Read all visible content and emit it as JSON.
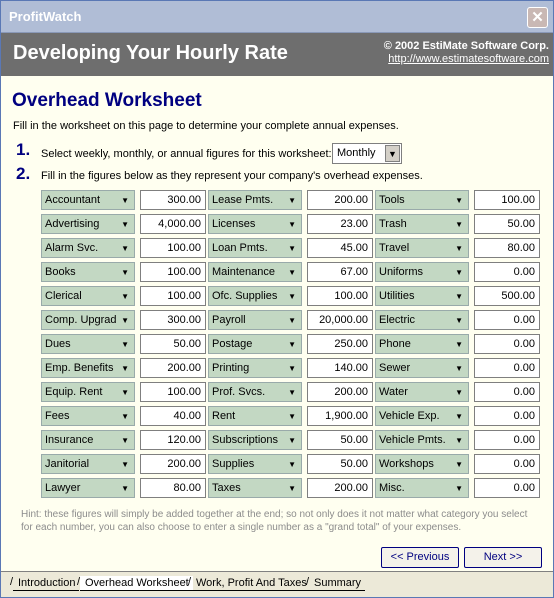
{
  "window": {
    "title": "ProfitWatch",
    "close_glyph": "✕"
  },
  "header": {
    "title": "Developing Your Hourly Rate",
    "copyright": "© 2002 EstiMate Software Corp.",
    "url": "http://www.estimatesoftware.com"
  },
  "worksheet": {
    "title": "Overhead Worksheet",
    "intro": "Fill in the worksheet on this page to determine your complete annual expenses.",
    "step1_number": "1.",
    "step1_text": "Select weekly, monthly, or annual figures for this worksheet:",
    "period_value": "Monthly",
    "step2_number": "2.",
    "step2_text": "Fill in the figures below as they represent your company's overhead expenses.",
    "columns": [
      [
        {
          "label": "Accountant",
          "amount": "300.00"
        },
        {
          "label": "Advertising",
          "amount": "4,000.00"
        },
        {
          "label": "Alarm Svc.",
          "amount": "100.00"
        },
        {
          "label": "Books",
          "amount": "100.00"
        },
        {
          "label": "Clerical",
          "amount": "100.00"
        },
        {
          "label": "Comp. Upgrad",
          "amount": "300.00"
        },
        {
          "label": "Dues",
          "amount": "50.00"
        },
        {
          "label": "Emp. Benefits",
          "amount": "200.00"
        },
        {
          "label": "Equip. Rent",
          "amount": "100.00"
        },
        {
          "label": "Fees",
          "amount": "40.00"
        },
        {
          "label": "Insurance",
          "amount": "120.00"
        },
        {
          "label": "Janitorial",
          "amount": "200.00"
        },
        {
          "label": "Lawyer",
          "amount": "80.00"
        }
      ],
      [
        {
          "label": "Lease Pmts.",
          "amount": "200.00"
        },
        {
          "label": "Licenses",
          "amount": "23.00"
        },
        {
          "label": "Loan Pmts.",
          "amount": "45.00"
        },
        {
          "label": "Maintenance",
          "amount": "67.00"
        },
        {
          "label": "Ofc. Supplies",
          "amount": "100.00"
        },
        {
          "label": "Payroll",
          "amount": "20,000.00"
        },
        {
          "label": "Postage",
          "amount": "250.00"
        },
        {
          "label": "Printing",
          "amount": "140.00"
        },
        {
          "label": "Prof. Svcs.",
          "amount": "200.00"
        },
        {
          "label": "Rent",
          "amount": "1,900.00"
        },
        {
          "label": "Subscriptions",
          "amount": "50.00"
        },
        {
          "label": "Supplies",
          "amount": "50.00"
        },
        {
          "label": "Taxes",
          "amount": "200.00"
        }
      ],
      [
        {
          "label": "Tools",
          "amount": "100.00"
        },
        {
          "label": "Trash",
          "amount": "50.00"
        },
        {
          "label": "Travel",
          "amount": "80.00"
        },
        {
          "label": "Uniforms",
          "amount": "0.00"
        },
        {
          "label": "Utilities",
          "amount": "500.00"
        },
        {
          "label": "Electric",
          "amount": "0.00"
        },
        {
          "label": "Phone",
          "amount": "0.00"
        },
        {
          "label": "Sewer",
          "amount": "0.00"
        },
        {
          "label": "Water",
          "amount": "0.00"
        },
        {
          "label": "Vehicle Exp.",
          "amount": "0.00"
        },
        {
          "label": "Vehicle Pmts.",
          "amount": "0.00"
        },
        {
          "label": "Workshops",
          "amount": "0.00"
        },
        {
          "label": "Misc.",
          "amount": "0.00"
        }
      ]
    ],
    "dropdown_glyph": "▼",
    "hint": "Hint: these figures will simply be added together at the end; so not only does it not matter what category you select for each number, you can also choose to enter a single number as a \"grand total\" of your expenses."
  },
  "nav": {
    "previous_label": "<< Previous",
    "next_label": "Next >>"
  },
  "tabs": [
    {
      "label": "Introduction"
    },
    {
      "label": "Overhead Worksheet"
    },
    {
      "label": "Work, Profit And Taxes"
    },
    {
      "label": "Summary"
    }
  ],
  "colors": {
    "header_bg": "#6e6e6e",
    "accent": "#000080",
    "dropdown_bg": "#c3d8c3"
  },
  "icons": {
    "close": "close-icon",
    "dropdown": "chevron-down-icon"
  }
}
